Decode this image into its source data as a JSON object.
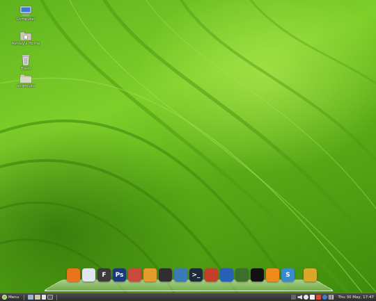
{
  "desktop": {
    "icons": [
      {
        "label": "Computer",
        "icon": "computer-icon"
      },
      {
        "label": "Ashley's Home",
        "icon": "home-folder-icon"
      },
      {
        "label": "Trash",
        "icon": "trash-icon"
      },
      {
        "label": "shortcuts",
        "icon": "folder-icon"
      }
    ]
  },
  "dock": {
    "items": [
      {
        "icon": "firefox-icon",
        "glyph": "",
        "color": "#e8741c"
      },
      {
        "icon": "text-editor-icon",
        "glyph": "",
        "color": "#dfe6ee"
      },
      {
        "icon": "flash-icon",
        "glyph": "F",
        "color": "#3a3a3a"
      },
      {
        "icon": "photoshop-icon",
        "glyph": "Ps",
        "color": "#1a3a78"
      },
      {
        "icon": "robot-icon",
        "glyph": "",
        "color": "#c94b3c"
      },
      {
        "icon": "chat-icon",
        "glyph": "",
        "color": "#e69a2b"
      },
      {
        "icon": "keyboard-icon",
        "glyph": "",
        "color": "#2f2f2f"
      },
      {
        "icon": "disk-utility-icon",
        "glyph": "",
        "color": "#3b7bb5"
      },
      {
        "icon": "terminal-icon",
        "glyph": ">_",
        "color": "#1e2a3a"
      },
      {
        "icon": "network-icon",
        "glyph": "",
        "color": "#c2402a"
      },
      {
        "icon": "headphones-icon",
        "glyph": "",
        "color": "#2860b8"
      },
      {
        "icon": "equalizer-icon",
        "glyph": "",
        "color": "#3c6e2c"
      },
      {
        "icon": "obs-icon",
        "glyph": "",
        "color": "#111111"
      },
      {
        "icon": "vlc-icon",
        "glyph": "",
        "color": "#f08a1c"
      },
      {
        "icon": "sync-icon",
        "glyph": "S",
        "color": "#3b8ac9"
      },
      {
        "icon": "archive-icon",
        "glyph": "",
        "color": "#d9a82a"
      }
    ]
  },
  "panel": {
    "menu_label": "Menu",
    "clock": "Thu 30 May, 17:47"
  }
}
